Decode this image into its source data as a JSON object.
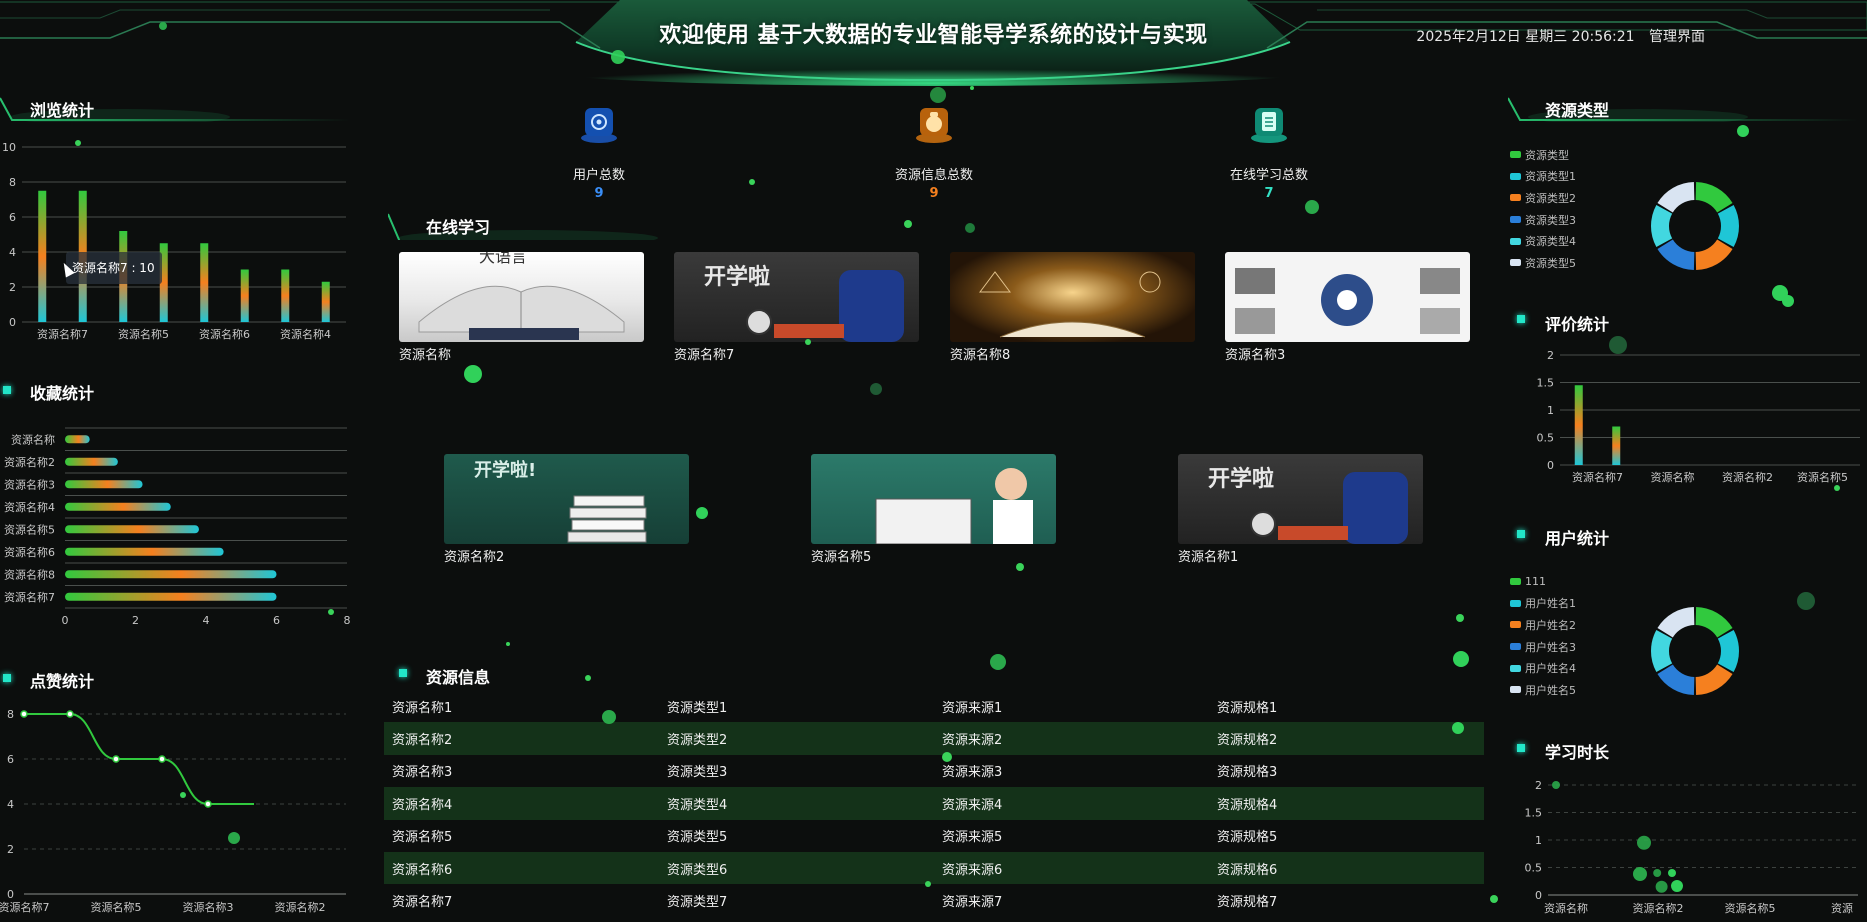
{
  "header": {
    "title": "欢迎使用 基于大数据的专业智能导学系统的设计与实现",
    "datetime": "2025年2月12日 星期三 20:56:21",
    "admin_link": "管理界面"
  },
  "colors": {
    "green": "#31c93e",
    "cyan": "#1fc6d6",
    "orange": "#f5801f",
    "blue": "#2b7fd9",
    "light_cyan": "#42d7e0",
    "white_blue": "#d9e4f2",
    "accent": "#22e6c8"
  },
  "panels": {
    "browse": "浏览统计",
    "favorite": "收藏统计",
    "like": "点赞统计",
    "online": "在线学习",
    "resource_info": "资源信息",
    "resource_type": "资源类型",
    "rating": "评价统计",
    "user": "用户统计",
    "study_time": "学习时长"
  },
  "stats": [
    {
      "label": "用户总数",
      "value": "9",
      "color": "#3a8ef6",
      "icon": "settings-gear-icon"
    },
    {
      "label": "资源信息总数",
      "value": "9",
      "color": "#f5801f",
      "icon": "money-bag-icon"
    },
    {
      "label": "在线学习总数",
      "value": "7",
      "color": "#34e0c4",
      "icon": "clipboard-icon"
    }
  ],
  "tooltip": "资源名称7 : 10",
  "courses_row1": [
    "资源名称",
    "资源名称7",
    "资源名称8",
    "资源名称3"
  ],
  "courses_row2": [
    "资源名称2",
    "资源名称5",
    "资源名称1"
  ],
  "resource_table": [
    [
      "资源名称1",
      "资源类型1",
      "资源来源1",
      "资源规格1"
    ],
    [
      "资源名称2",
      "资源类型2",
      "资源来源2",
      "资源规格2"
    ],
    [
      "资源名称3",
      "资源类型3",
      "资源来源3",
      "资源规格3"
    ],
    [
      "资源名称4",
      "资源类型4",
      "资源来源4",
      "资源规格4"
    ],
    [
      "资源名称5",
      "资源类型5",
      "资源来源5",
      "资源规格5"
    ],
    [
      "资源名称6",
      "资源类型6",
      "资源来源6",
      "资源规格6"
    ],
    [
      "资源名称7",
      "资源类型7",
      "资源来源7",
      "资源规格7"
    ]
  ],
  "chart_data": [
    {
      "id": "browse",
      "type": "bar",
      "ylim": [
        0,
        10
      ],
      "yticks": [
        0,
        2,
        4,
        6,
        8,
        10
      ],
      "values": [
        7.5,
        7.5,
        5.2,
        4.5,
        4.5,
        3.0,
        3.0,
        2.3
      ],
      "xticklabels": [
        "资源名称7",
        "资源名称5",
        "资源名称6",
        "资源名称4"
      ]
    },
    {
      "id": "favorite",
      "type": "bar",
      "orientation": "horizontal",
      "xlim": [
        0,
        8
      ],
      "xticks": [
        0,
        2,
        4,
        6,
        8
      ],
      "categories": [
        "资源名称",
        "资源名称2",
        "资源名称3",
        "资源名称4",
        "资源名称5",
        "资源名称6",
        "资源名称8",
        "资源名称7"
      ],
      "values": [
        0.7,
        1.5,
        2.2,
        3.0,
        3.8,
        4.5,
        6.0,
        6.0
      ]
    },
    {
      "id": "like",
      "type": "line",
      "ylim": [
        0,
        8
      ],
      "yticks": [
        0,
        2,
        4,
        6,
        8
      ],
      "x": [
        0,
        1,
        2,
        3,
        4,
        5
      ],
      "values": [
        8,
        8,
        6,
        6,
        4,
        4
      ],
      "xticklabels": [
        "资源名称7",
        "资源名称5",
        "资源名称3",
        "资源名称2"
      ]
    },
    {
      "id": "resource_type",
      "type": "pie",
      "categories": [
        "资源类型",
        "资源类型1",
        "资源类型2",
        "资源类型3",
        "资源类型4",
        "资源类型5"
      ],
      "values": [
        1,
        1,
        1,
        1,
        1,
        1
      ]
    },
    {
      "id": "rating",
      "type": "bar",
      "ylim": [
        0,
        2
      ],
      "yticks": [
        0,
        0.5,
        1,
        1.5,
        2
      ],
      "values": [
        1.45,
        0.7,
        0,
        0,
        0,
        0,
        0,
        0
      ],
      "xticklabels": [
        "资源名称7",
        "资源名称",
        "资源名称2",
        "资源名称5"
      ]
    },
    {
      "id": "user",
      "type": "pie",
      "categories": [
        "111",
        "用户姓名1",
        "用户姓名2",
        "用户姓名3",
        "用户姓名4",
        "用户姓名5"
      ],
      "values": [
        1,
        1,
        1,
        1,
        1,
        1
      ]
    },
    {
      "id": "study_time",
      "type": "scatter",
      "ylim": [
        0,
        2
      ],
      "yticks": [
        0,
        0.5,
        1,
        1.5,
        2
      ],
      "x": [
        0,
        2,
        2.3,
        2.4
      ],
      "values": [
        2,
        0.95,
        0.4,
        0.15
      ],
      "sizes": [
        4,
        7,
        4,
        6
      ],
      "xticklabels": [
        "资源名称",
        "资源名称2",
        "资源名称5",
        "资源"
      ]
    }
  ]
}
